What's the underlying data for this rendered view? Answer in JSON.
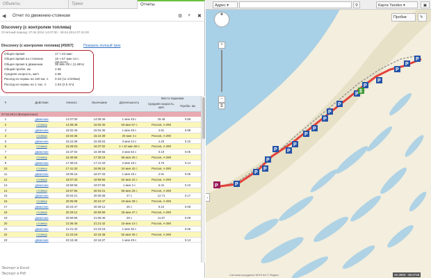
{
  "tabs": [
    "Объекты",
    "Треки",
    "Отчеты"
  ],
  "report": {
    "header": "Отчет по движению-стоянкам",
    "object_name": "Discovery (с контролем топлива)",
    "period": "Отчетный период: 27.04.2014 14:07:00 - 28.04.2014 07:41:00",
    "subtitle": "Discovery (с контролем топлива) [#5007]",
    "show_track": "Показать полный трек"
  },
  "stats": [
    {
      "k": "Общее время",
      "v": "17 ч 34 мин"
    },
    {
      "k": "Общее время на стоянках",
      "v": "16 ч 57 мин 14 с (96.51%)"
    },
    {
      "k": "Общее время в движении",
      "v": "36 мин 48 с (3.49%)"
    },
    {
      "k": "Общий пробег, км",
      "v": "2.96"
    },
    {
      "k": "Средняя скорость, км/ч",
      "v": "4.86"
    },
    {
      "k": "Расход из нормы на 100 км, л",
      "v": "0.33 (11 л/100км)"
    },
    {
      "k": "Расход из нормы на 1 час, л",
      "v": "1.53 (2.5 л/ч)"
    }
  ],
  "table": {
    "headers": {
      "num": "#",
      "action": "Действие",
      "start": "Начало",
      "end": "Окончание",
      "duration": "Длительность",
      "place": "Место парковки",
      "speed": "Средняя скорость, км/ч",
      "mileage": "Пробег, км"
    },
    "day": "27.04.2014 (Воскресенье)",
    "rows": [
      [
        "1",
        "движение",
        "14:07:00",
        "14:08:49",
        "1 мин 49 с",
        "29.48",
        "0.89"
      ],
      [
        "2",
        "стоянка",
        "14:08:49",
        "15:02:46",
        "53 мин 57 с",
        "Россия, А-290",
        ""
      ],
      [
        "3",
        "движение",
        "15:02:46",
        "15:04:35",
        "1 мин 49 с",
        "2.91",
        "0.88"
      ],
      [
        "4",
        "стоянка",
        "15:04:35",
        "15:24:39",
        "20 мин 4 с",
        "Россия, А-290",
        ""
      ],
      [
        "5",
        "движение",
        "15:24:39",
        "15:28:03",
        "3 мин 24 с",
        "4.20",
        "0.10"
      ],
      [
        "6",
        "стоянка",
        "15:28:03",
        "16:37:02",
        "1 ч 10 мин 59 с",
        "Россия, А-290",
        ""
      ],
      [
        "7",
        "движение",
        "16:37:02",
        "16:39:55",
        "2 мин 53 с",
        "0.19",
        "0.05"
      ],
      [
        "8",
        "стоянка",
        "16:39:55",
        "17:39:15",
        "59 мин 20 с",
        "Россия, А-290",
        ""
      ],
      [
        "9",
        "движение",
        "17:39:15",
        "17:41:33",
        "2 мин 18 с",
        "3.76",
        "0.14"
      ],
      [
        "10",
        "стоянка",
        "17:41:33",
        "18:06:15",
        "24 мин 42 с",
        "Россия, А-290",
        ""
      ],
      [
        "11",
        "движение",
        "18:06:15",
        "18:07:33",
        "1 мин 18 с",
        "2.91",
        "0.05"
      ],
      [
        "12",
        "стоянка",
        "18:07:33",
        "18:59:55",
        "52 мин 22 с",
        "Россия, А-290",
        ""
      ],
      [
        "13",
        "движение",
        "18:59:55",
        "19:07:55",
        "1 мин 3 с",
        "6.34",
        "0.10"
      ],
      [
        "14",
        "стоянка",
        "19:07:55",
        "20:04:21",
        "56 мин 26 с",
        "Россия, А-290",
        ""
      ],
      [
        "15",
        "движение",
        "20:04:21",
        "20:05:08",
        "47 с",
        "12.71",
        "0.17"
      ],
      [
        "16",
        "стоянка",
        "20:05:08",
        "20:24:47",
        "19 мин 39 с",
        "Россия, А-290",
        ""
      ],
      [
        "17",
        "движение",
        "20:24:47",
        "20:29:12",
        "25 с",
        "9.22",
        "0.06"
      ],
      [
        "18",
        "стоянка",
        "20:29:12",
        "20:59:59",
        "29 мин 47 с",
        "Россия, А-290",
        ""
      ],
      [
        "19",
        "движение",
        "20:59:59",
        "21:06:46",
        "29 с",
        "11.97",
        "0.09"
      ],
      [
        "20",
        "стоянка",
        "21:06:46",
        "21:21:42",
        "15 мин 14 с",
        "Россия, А-290",
        ""
      ],
      [
        "21",
        "движение",
        "21:21:42",
        "21:23:18",
        "1 мин 36 с",
        "",
        "0.06"
      ],
      [
        "22",
        "стоянка",
        "21:23:18",
        "22:15:48",
        "52 мин 30 с",
        "Россия, А-290",
        ""
      ],
      [
        "23",
        "движение",
        "22:15:48",
        "22:16:37",
        "1 мин 49 с",
        "",
        "0.13"
      ]
    ]
  },
  "export": [
    "Экспорт в Excel",
    "Экспорт в Pdf"
  ],
  "map": {
    "address_label": "Адрес",
    "map_type": "Карта Yandex",
    "traffic": "Пробки",
    "coords": "45.3993 : 36.6748",
    "copyright": "Система координат WGS 84 © Яндекс"
  }
}
